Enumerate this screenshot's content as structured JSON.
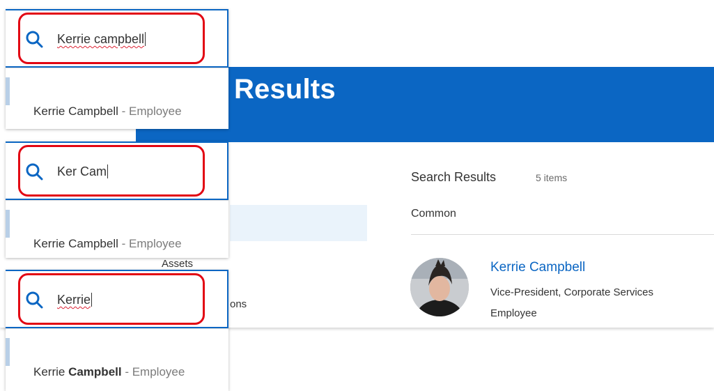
{
  "page": {
    "header_title": "h Results",
    "left_panel": {
      "assets_label": "Assets",
      "ons_label": "ons"
    },
    "results": {
      "title": "Search Results",
      "count": "5 items",
      "section": "Common",
      "person": {
        "name": "Kerrie Campbell",
        "title": "Vice-President, Corporate Services",
        "type": "Employee"
      }
    }
  },
  "panels": [
    {
      "query": "Kerrie campbell",
      "result_name_regular": "Kerrie Campbell",
      "result_name_bold": "",
      "result_type": " - Employee"
    },
    {
      "query": "Ker Cam",
      "result_name_regular": "Kerrie Campbell",
      "result_name_bold": "",
      "result_type": " - Employee"
    },
    {
      "query": "Kerrie",
      "result_name_regular": "Kerrie ",
      "result_name_bold": "Campbell",
      "result_type": " - Employee"
    }
  ],
  "colors": {
    "header_blue": "#0b66c3",
    "highlight_red": "#e20613",
    "link_blue": "#0b66c3"
  },
  "icons": {
    "search": "search-icon"
  }
}
